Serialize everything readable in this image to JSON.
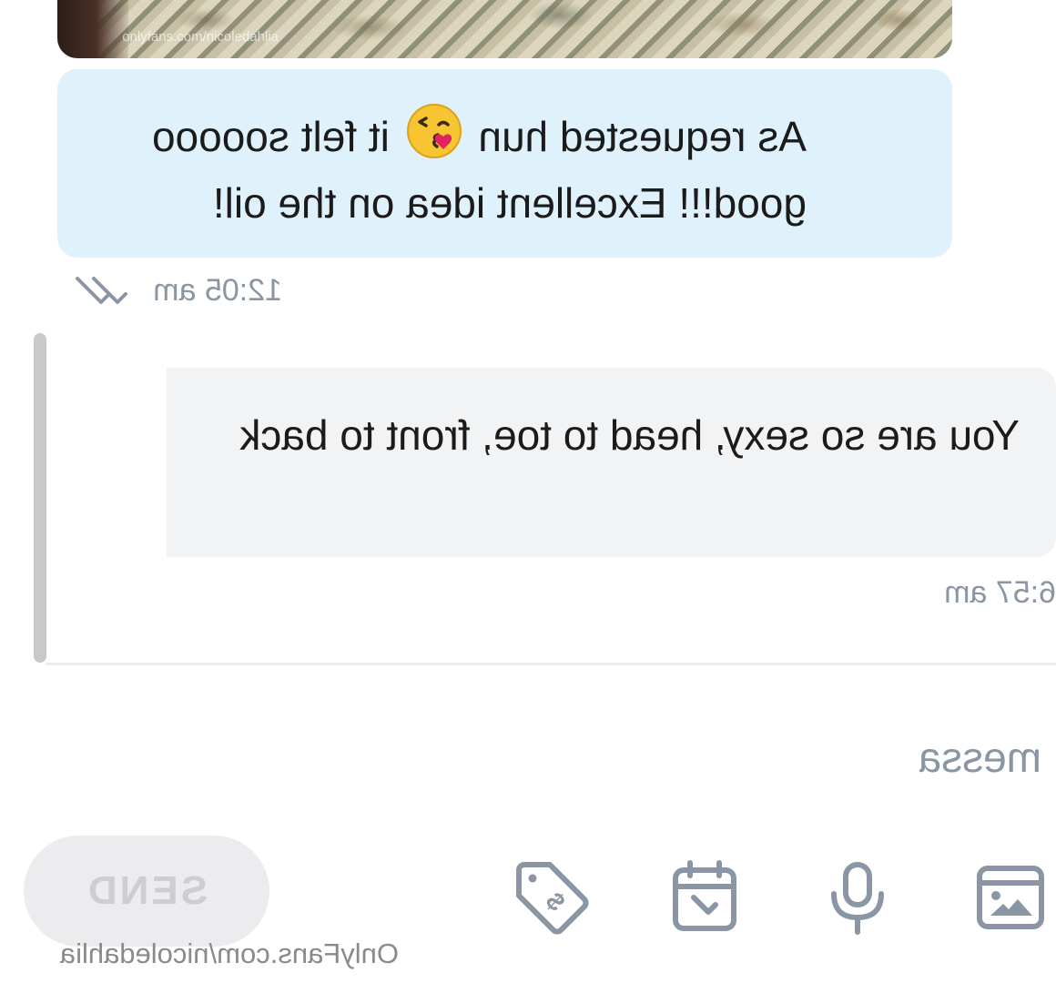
{
  "photo": {
    "watermark": "onlyfans.com/nicoledahlia"
  },
  "messages": [
    {
      "direction": "sent",
      "text_before_emoji": "As requested hun ",
      "emoji": "kissing-face-with-heart",
      "text_after_emoji": " it felt sooooo good!!! Excellent idea on the oil!",
      "time": "12:05 am",
      "status_icon": "double-check-icon",
      "bubble_color": "#dff2fb"
    },
    {
      "direction": "received",
      "text": "You are so sexy, head to toe, front to back",
      "time": "6:57 am",
      "bubble_color": "#f2f3f4"
    }
  ],
  "composer": {
    "placeholder": "message",
    "value": "",
    "icons": [
      "image-icon",
      "microphone-icon",
      "calendar-icon",
      "price-tag-icon"
    ],
    "send_label": "SEND"
  },
  "watermark": "OnlyFans.com/nicoledahlia",
  "colors": {
    "accent_muted": "#8a96a3",
    "send_disabled_bg": "#ececee"
  }
}
